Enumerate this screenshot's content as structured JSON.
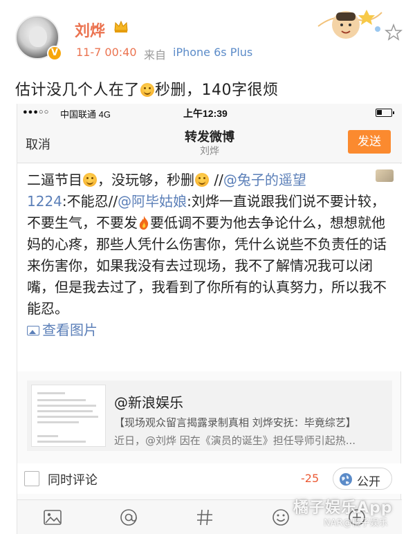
{
  "post": {
    "username": "刘烨",
    "time": "11-7 00:40",
    "from_label": "来自",
    "source": "iPhone 6s Plus",
    "text_before": "估计没几个人在了",
    "text_after": "秒删，140字很烦"
  },
  "phone": {
    "status": {
      "signal": "●●●○○",
      "carrier": "中国联通  4G",
      "time": "上午12:39",
      "battery_level": 0.35
    },
    "nav": {
      "cancel": "取消",
      "title": "转发微博",
      "subtitle": "刘烨",
      "send": "发送"
    },
    "compose": {
      "p1": "二逼节目",
      "p2": "，没玩够，秒删",
      "p3": " //",
      "mention1": "@兔子的遥望",
      "mention1b": "1224",
      "p4": ":不能忍//",
      "mention2": "@阿毕姑娘",
      "p5": ":刘烨一直说跟我们说不要计较，不要生气，不要发",
      "p6": "要低调不要为他去争论什么，想想就他妈的心疼，那些人凭什么伤害你，凭什么说些不负责任的话来伤害你，如果我没有去过现场，我不了解情况我可以闭嘴，但是我去过了，我看到了你所有的认真努力，所以我不能忍。",
      "view_image": "查看图片"
    },
    "quote": {
      "author": "@新浪娱乐",
      "title": "【现场观众留言揭露录制真相 刘烨安抚：毕竟综艺】",
      "body": "近日，@刘烨 因在《演员的诞生》担任导师引起热..."
    },
    "options": {
      "comment_label": "同时评论",
      "char_count": "-25",
      "visibility": "公开"
    },
    "toolbar": [
      "image-icon",
      "at-icon",
      "hashtag-icon",
      "emoji-icon",
      "plus-icon"
    ]
  },
  "watermark": {
    "main": "橘子娱乐App",
    "sub": "NAR@橘子娱乐"
  },
  "colors": {
    "accent_orange": "#eb7350",
    "send_button": "#fb8a2f",
    "link_blue": "#5b7fb8"
  }
}
